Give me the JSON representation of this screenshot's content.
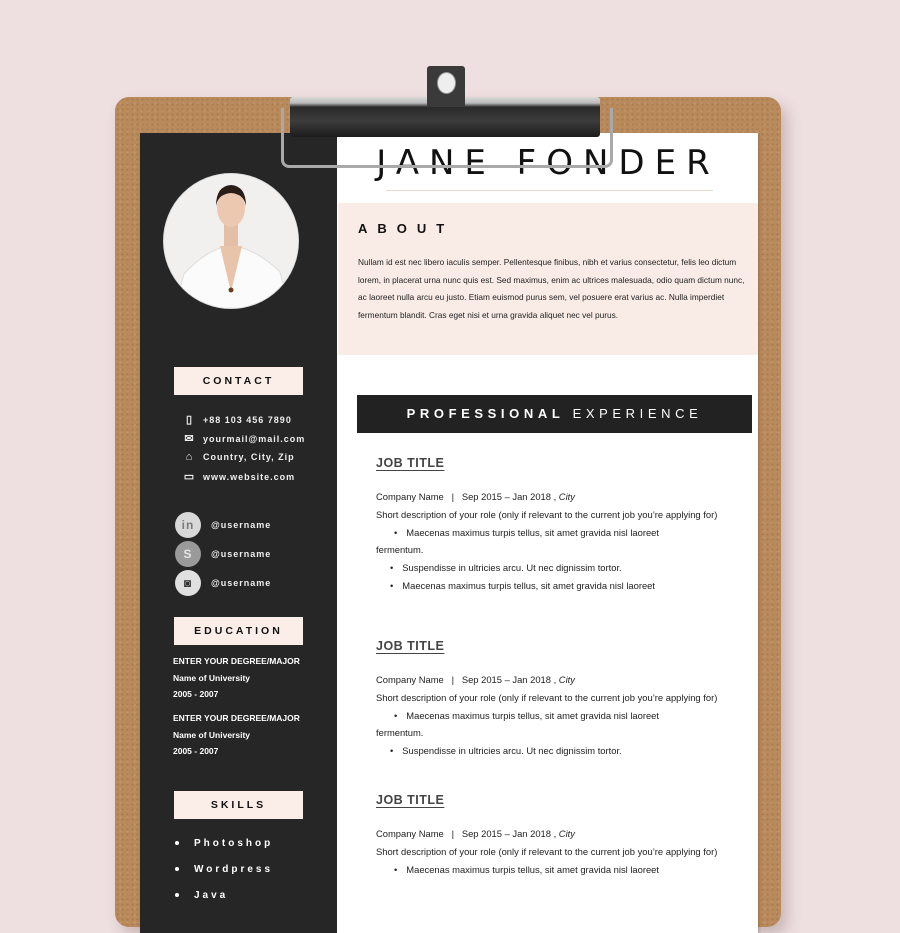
{
  "resume": {
    "name": "JANE FONDER",
    "about": {
      "heading": "ABOUT",
      "text": "Nullam id est nec libero iaculis semper. Pellentesque finibus, nibh et varius consectetur, felis leo dictum lorem, in placerat urna nunc quis est. Sed maximus, enim ac ultrices malesuada, odio quam dictum nunc, ac laoreet nulla arcu eu justo. Etiam euismod purus sem, vel posuere erat varius ac. Nulla imperdiet fermentum blandit. Cras eget nisi et urna gravida aliquet nec vel purus."
    },
    "contact": {
      "heading": "CONTACT",
      "items": [
        {
          "icon": "phone-icon",
          "glyph": "▯",
          "text": "+88  103 456 7890"
        },
        {
          "icon": "mail-icon",
          "glyph": "✉",
          "text": "yourmail@mail.com"
        },
        {
          "icon": "home-icon",
          "glyph": "⌂",
          "text": "Country, City, Zip"
        },
        {
          "icon": "monitor-icon",
          "glyph": "▭",
          "text": "www.website.com"
        }
      ]
    },
    "social": [
      {
        "icon": "linkedin-icon",
        "glyph": "in",
        "handle": "@username"
      },
      {
        "icon": "skype-icon",
        "glyph": "S",
        "handle": "@username"
      },
      {
        "icon": "instagram-icon",
        "glyph": "◙",
        "handle": "@username"
      }
    ],
    "education": {
      "heading": "EDUCATION",
      "entries": [
        {
          "degree": "ENTER YOUR DEGREE/MAJOR",
          "school": "Name of University",
          "years": "2005 - 2007"
        },
        {
          "degree": "ENTER YOUR DEGREE/MAJOR",
          "school": "Name of University",
          "years": "2005 - 2007"
        }
      ]
    },
    "skills": {
      "heading": "SKILLS",
      "items": [
        "Photoshop",
        "Wordpress",
        "Java"
      ]
    },
    "experience": {
      "heading_bold": "PROFESSIONAL",
      "heading_light": "EXPERIENCE",
      "jobs": [
        {
          "title": "JOB TITLE",
          "company": "Company Name",
          "dates": "Sep 2015 – Jan 2018 ,",
          "city": "City",
          "description": "Short description of your role (only if relevant to the current job you’re applying for)",
          "bullet_first": "Maecenas maximus turpis tellus, sit amet gravida nisl laoreet",
          "bullet_first_cont": "fermentum.",
          "bullets": [
            "Suspendisse in ultricies arcu. Ut nec dignissim tortor.",
            "Maecenas maximus turpis tellus, sit amet gravida nisl laoreet"
          ]
        },
        {
          "title": "JOB TITLE",
          "company": "Company Name",
          "dates": "Sep 2015 – Jan 2018 ,",
          "city": "City",
          "description": "Short description of your role (only if relevant to the current job you’re applying for)",
          "bullet_first": "Maecenas maximus turpis tellus, sit amet gravida nisl laoreet",
          "bullet_first_cont": "fermentum.",
          "bullets": [
            "Suspendisse in ultricies arcu. Ut nec dignissim tortor."
          ]
        },
        {
          "title": "JOB TITLE",
          "company": "Company Name",
          "dates": "Sep 2015 – Jan 2018 ,",
          "city": "City",
          "description": "Short description of your role (only if relevant to the current job you’re applying for)",
          "bullet_first": "Maecenas maximus turpis tellus, sit amet gravida nisl laoreet"
        }
      ]
    }
  },
  "colors": {
    "background": "#eedfe0",
    "sidebar": "#262626",
    "accent_pink": "#f9ece6",
    "clipboard": "#b98a5c"
  }
}
